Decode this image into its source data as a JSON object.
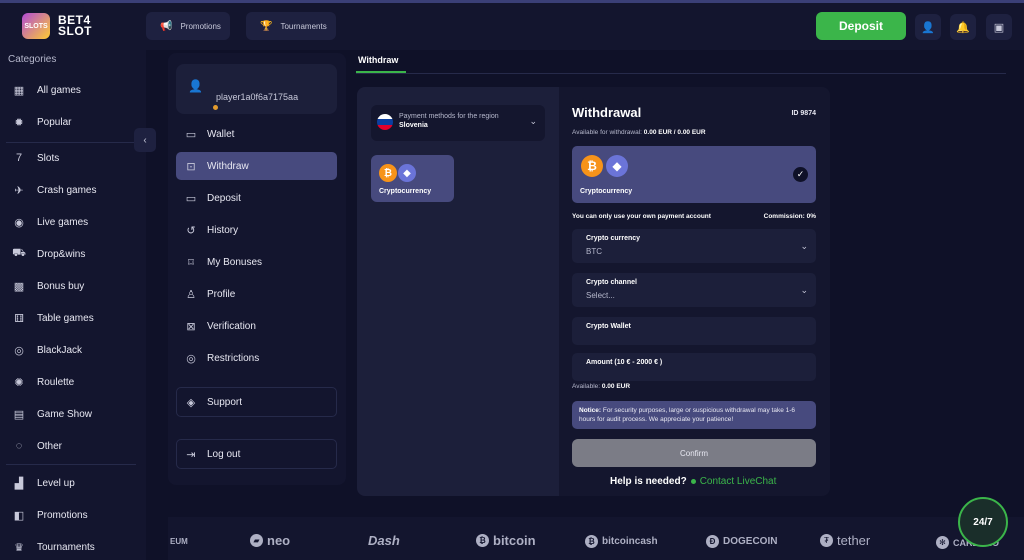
{
  "header": {
    "logo_text_1": "BET4",
    "logo_text_2": "SLOT",
    "logo_badge": "SLOTS",
    "promotions": "Promotions",
    "tournaments": "Tournaments",
    "deposit": "Deposit"
  },
  "sidebar": {
    "title": "Categories",
    "items": [
      {
        "label": "All games",
        "icon": "grid-icon"
      },
      {
        "label": "Popular",
        "icon": "star-icon"
      },
      {
        "label": "Slots",
        "icon": "slot-icon"
      },
      {
        "label": "Crash games",
        "icon": "plane-icon"
      },
      {
        "label": "Live games",
        "icon": "live-icon"
      },
      {
        "label": "Drop&wins",
        "icon": "drop-icon"
      },
      {
        "label": "Bonus buy",
        "icon": "gift-icon"
      },
      {
        "label": "Table games",
        "icon": "dice-icon"
      },
      {
        "label": "BlackJack",
        "icon": "chip-icon"
      },
      {
        "label": "Roulette",
        "icon": "roulette-icon"
      },
      {
        "label": "Game Show",
        "icon": "show-icon"
      },
      {
        "label": "Other",
        "icon": "other-icon"
      },
      {
        "label": "Level up",
        "icon": "level-icon"
      },
      {
        "label": "Promotions",
        "icon": "promo-icon"
      },
      {
        "label": "Tournaments",
        "icon": "trophy-icon"
      }
    ]
  },
  "account": {
    "username": "player1a0f6a7175aa",
    "menu": [
      {
        "label": "Wallet"
      },
      {
        "label": "Withdraw"
      },
      {
        "label": "Deposit"
      },
      {
        "label": "History"
      },
      {
        "label": "My Bonuses"
      },
      {
        "label": "Profile"
      },
      {
        "label": "Verification"
      },
      {
        "label": "Restrictions"
      },
      {
        "label": "Support"
      },
      {
        "label": "Log out"
      }
    ]
  },
  "withdraw": {
    "tab": "Withdraw",
    "region_label": "Payment methods for the region",
    "region_name": "Slovenia",
    "method_label": "Cryptocurrency",
    "title": "Withdrawal",
    "id": "ID 9874",
    "available_label": "Available for withdrawal:",
    "available_value": "0.00 EUR / 0.00 EUR",
    "selected_label": "Cryptocurrency",
    "own_account_note": "You can only use your own payment account",
    "commission": "Commission: 0%",
    "crypto_currency_label": "Crypto currency",
    "crypto_currency_value": "BTC",
    "crypto_channel_label": "Crypto channel",
    "crypto_channel_value": "Select...",
    "wallet_label": "Crypto Wallet",
    "amount_label": "Amount (10 € - 2000 € )",
    "available_short_label": "Available:",
    "available_short_value": "0.00 EUR",
    "notice_title": "Notice:",
    "notice_text": "For security purposes, large or suspicious withdrawal may take 1-6 hours for audit process. We appreciate your patience!",
    "confirm": "Confirm",
    "help": "Help is needed?",
    "contact": "Contact LiveChat"
  },
  "strip": {
    "items": [
      "EUM",
      "neo",
      "Dash",
      "bitcoin",
      "bitcoincash",
      "DOGECOIN",
      "tether",
      "CARDANO"
    ]
  },
  "chat": {
    "label": "24/7"
  },
  "colors": {
    "accent": "#3bb54a",
    "active": "#474a7e",
    "background": "#0f1128",
    "panel": "#13152e"
  }
}
